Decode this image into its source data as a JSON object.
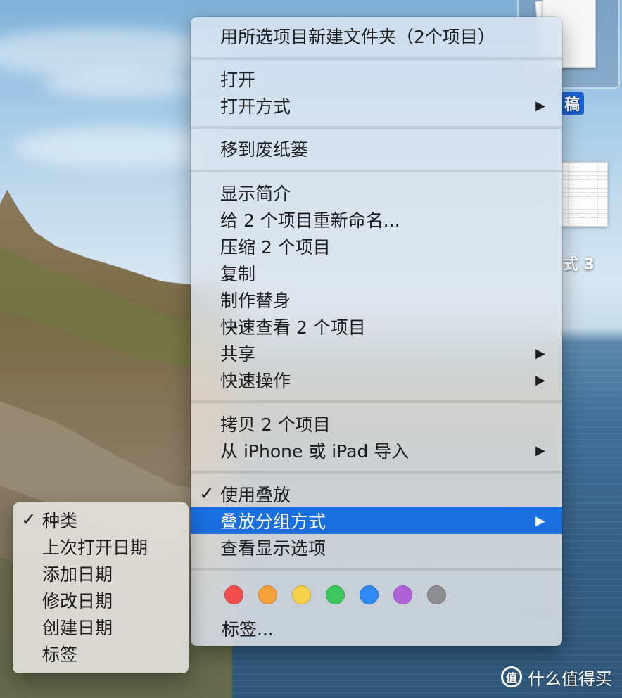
{
  "desktop": {
    "icons": [
      {
        "label": "稿",
        "selected": true
      },
      {
        "label": "式 3",
        "selected": false
      }
    ]
  },
  "context_menu": {
    "groups": [
      {
        "items": [
          {
            "label": "用所选项目新建文件夹（2个项目）"
          }
        ]
      },
      {
        "items": [
          {
            "label": "打开"
          },
          {
            "label": "打开方式",
            "submenu": true
          }
        ]
      },
      {
        "items": [
          {
            "label": "移到废纸篓"
          }
        ]
      },
      {
        "items": [
          {
            "label": "显示简介"
          },
          {
            "label": "给 2 个项目重新命名..."
          },
          {
            "label": "压缩 2 个项目"
          },
          {
            "label": "复制"
          },
          {
            "label": "制作替身"
          },
          {
            "label": "快速查看 2 个项目"
          },
          {
            "label": "共享",
            "submenu": true
          },
          {
            "label": "快速操作",
            "submenu": true
          }
        ]
      },
      {
        "items": [
          {
            "label": "拷贝 2 个项目"
          },
          {
            "label": "从 iPhone 或 iPad 导入",
            "submenu": true
          }
        ]
      },
      {
        "items": [
          {
            "label": "使用叠放",
            "checked": true
          },
          {
            "label": "叠放分组方式",
            "submenu": true,
            "highlighted": true
          },
          {
            "label": "查看显示选项"
          }
        ]
      }
    ],
    "tags": {
      "colors": [
        "#f24e4e",
        "#f7a03c",
        "#f8d14a",
        "#3cc75d",
        "#2f8bf3",
        "#b061d8",
        "#8e8e92"
      ],
      "label": "标签..."
    },
    "highlight_color": "#1a6fe0",
    "check_glyph": "✓",
    "arrow_glyph": "▶"
  },
  "submenu_group_by": {
    "items": [
      {
        "label": "种类",
        "checked": true
      },
      {
        "label": "上次打开日期"
      },
      {
        "label": "添加日期"
      },
      {
        "label": "修改日期"
      },
      {
        "label": "创建日期"
      },
      {
        "label": "标签"
      }
    ]
  },
  "watermark": {
    "logo": "值",
    "text": "什么值得买"
  }
}
